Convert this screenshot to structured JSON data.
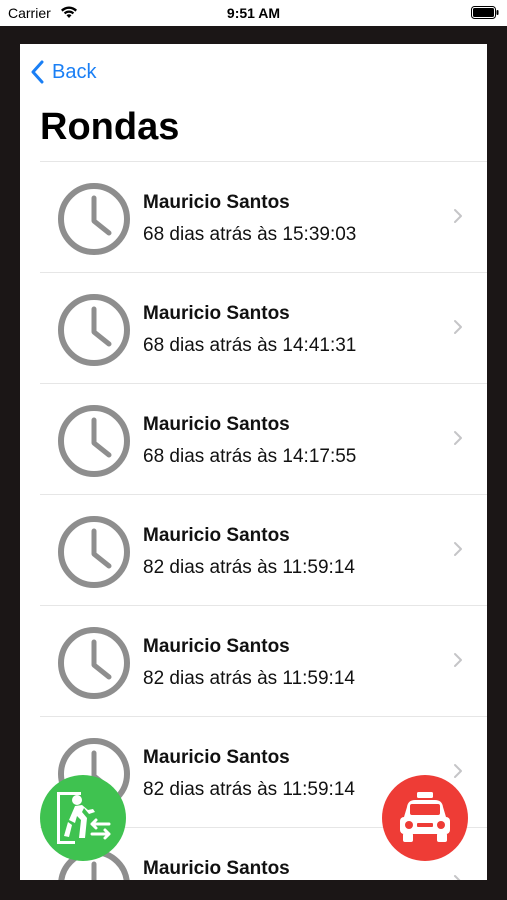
{
  "status_bar": {
    "carrier": "Carrier",
    "time": "9:51 AM"
  },
  "nav": {
    "back_label": "Back",
    "title": "Rondas"
  },
  "rows": [
    {
      "name": "Mauricio Santos",
      "subtitle": "68 dias atrás às 15:39:03"
    },
    {
      "name": "Mauricio Santos",
      "subtitle": "68 dias atrás às 14:41:31"
    },
    {
      "name": "Mauricio Santos",
      "subtitle": "68 dias atrás às 14:17:55"
    },
    {
      "name": "Mauricio Santos",
      "subtitle": "82 dias atrás às 11:59:14"
    },
    {
      "name": "Mauricio Santos",
      "subtitle": "82 dias atrás às 11:59:14"
    },
    {
      "name": "Mauricio Santos",
      "subtitle": "82 dias atrás às 11:59:14"
    },
    {
      "name": "Mauricio Santos",
      "subtitle": ""
    }
  ],
  "icons": {
    "row_icon": "clock-icon",
    "row_accessory": "chevron-right-icon",
    "fab_left": "exit-walk-icon",
    "fab_right": "car-icon"
  },
  "colors": {
    "accent": "#1a7ff5",
    "fab_left": "#3fc250",
    "fab_right": "#ee3c36",
    "clock": "#8e8e8e"
  }
}
